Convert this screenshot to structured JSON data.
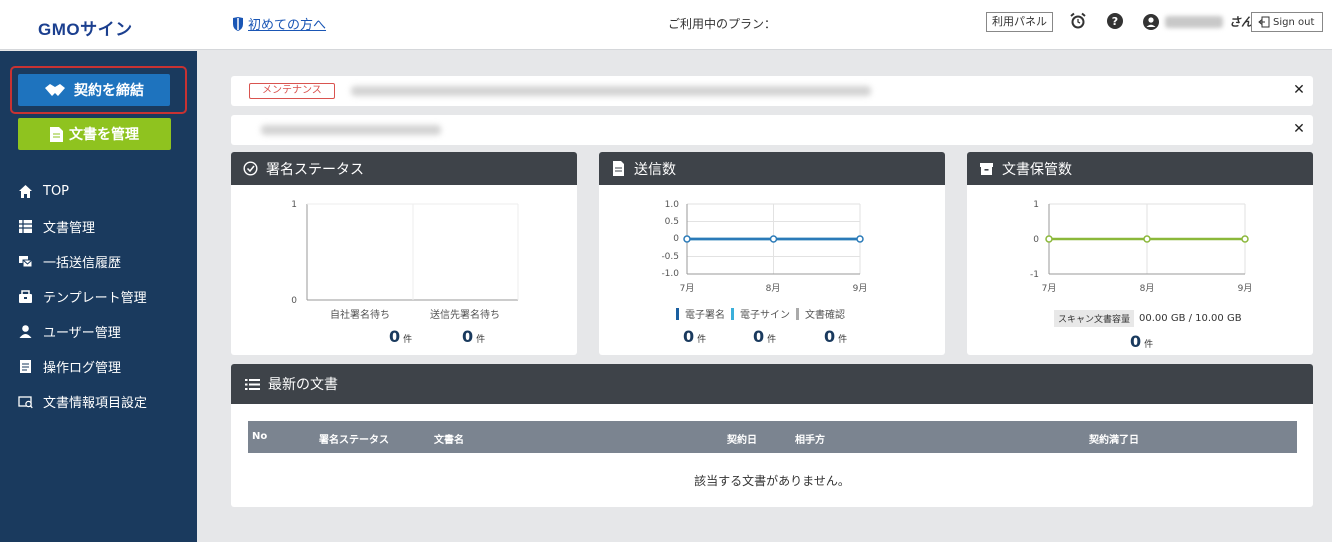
{
  "header": {
    "logo": "GMOサイン",
    "guide_link": "初めての方へ",
    "plan_label": "ご利用中のプラン：",
    "panel_button": "利用パネル",
    "user_suffix": "さん",
    "signout": "Sign out"
  },
  "sidebar": {
    "contract_button": "契約を締結",
    "manage_button": "文書を管理",
    "items": [
      {
        "label": "TOP",
        "icon": "home-icon"
      },
      {
        "label": "文書管理",
        "icon": "table-icon"
      },
      {
        "label": "一括送信履歴",
        "icon": "batch-send-icon"
      },
      {
        "label": "テンプレート管理",
        "icon": "template-icon"
      },
      {
        "label": "ユーザー管理",
        "icon": "user-icon"
      },
      {
        "label": "操作ログ管理",
        "icon": "log-icon"
      },
      {
        "label": "文書情報項目設定",
        "icon": "doc-info-icon"
      }
    ]
  },
  "notices": {
    "tag": "メンテナンス"
  },
  "signature_status": {
    "title": "署名ステータス",
    "categories": [
      "自社署名待ち",
      "送信先署名待ち"
    ],
    "y_ticks": [
      "1",
      "0"
    ],
    "counts": [
      "0",
      "0"
    ],
    "unit": "件"
  },
  "sent_count": {
    "title": "送信数",
    "y_ticks": [
      "1.0",
      "0.5",
      "0",
      "-0.5",
      "-1.0"
    ],
    "x_ticks": [
      "7月",
      "8月",
      "9月"
    ],
    "legend": [
      "電子署名",
      "電子サイン",
      "文書確認"
    ],
    "counts": [
      "0",
      "0",
      "0"
    ],
    "unit": "件"
  },
  "storage": {
    "title": "文書保管数",
    "y_ticks": [
      "1",
      "0",
      "-1"
    ],
    "x_ticks": [
      "7月",
      "8月",
      "9月"
    ],
    "scan_label": "スキャン文書容量",
    "scan_value": "00.00 GB / 10.00 GB",
    "count": "0",
    "unit": "件"
  },
  "latest_docs": {
    "title": "最新の文書",
    "columns": [
      "No",
      "署名ステータス",
      "文書名",
      "契約日",
      "相手方",
      "契約満了日"
    ],
    "empty_message": "該当する文書がありません。"
  },
  "colors": {
    "sidebar": "#1a3a5e",
    "contract_button": "#1e73be",
    "manage_button": "#8fc31f",
    "card_header": "#3e4349",
    "sent_line": "#2a7ab8",
    "storage_line": "#8bb83a",
    "legend_esign": "#1a5fa0",
    "legend_esign2": "#3bafda",
    "legend_confirm": "#aaaaaa"
  },
  "chart_data": [
    {
      "type": "bar",
      "title": "署名ステータス",
      "categories": [
        "自社署名待ち",
        "送信先署名待ち"
      ],
      "values": [
        0,
        0
      ],
      "ylim": [
        0,
        1
      ]
    },
    {
      "type": "line",
      "title": "送信数",
      "x": [
        "7月",
        "8月",
        "9月"
      ],
      "series": [
        {
          "name": "電子署名",
          "values": [
            0,
            0,
            0
          ]
        },
        {
          "name": "電子サイン",
          "values": [
            0,
            0,
            0
          ]
        },
        {
          "name": "文書確認",
          "values": [
            0,
            0,
            0
          ]
        }
      ],
      "ylim": [
        -1.0,
        1.0
      ]
    },
    {
      "type": "line",
      "title": "文書保管数",
      "x": [
        "7月",
        "8月",
        "9月"
      ],
      "series": [
        {
          "values": [
            0,
            0,
            0
          ]
        }
      ],
      "ylim": [
        -1,
        1
      ]
    }
  ]
}
